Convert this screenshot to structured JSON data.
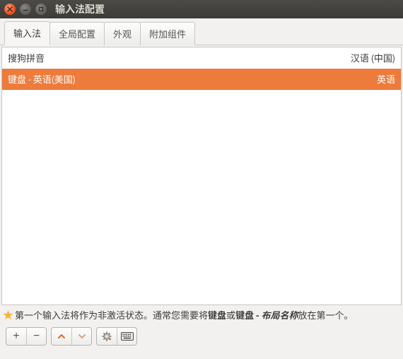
{
  "window": {
    "title": "输入法配置"
  },
  "tabs": [
    {
      "label": "输入法",
      "active": true
    },
    {
      "label": "全局配置",
      "active": false
    },
    {
      "label": "外观",
      "active": false
    },
    {
      "label": "附加组件",
      "active": false
    }
  ],
  "input_methods": [
    {
      "name": "搜狗拼音",
      "lang": "汉语 (中国)",
      "selected": false
    },
    {
      "name": "键盘 - 英语(美国)",
      "lang": "英语",
      "selected": true
    }
  ],
  "hint": {
    "pre": "第一个输入法将作为非激活状态。通常您需要将",
    "bold1": "键盘",
    "mid": "或",
    "bold2": "键盘 - ",
    "italic": "布局名称",
    "post": "放在第一个。"
  },
  "toolbar": {
    "add_label": "+",
    "remove_label": "−",
    "up_label": "⌃",
    "down_label": "⌄"
  }
}
